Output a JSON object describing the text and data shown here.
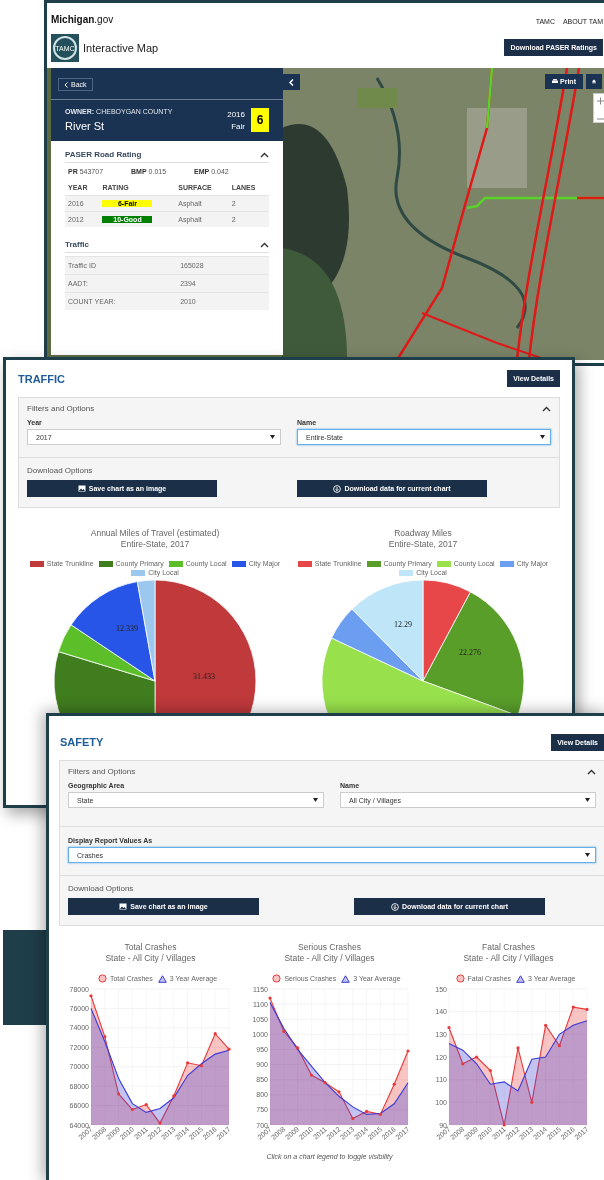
{
  "map_window": {
    "site_title": "**Michigan**.gov",
    "nav_links": [
      "TAMC",
      "ABOUT TAM"
    ],
    "logo_text": "TAMC",
    "app_title": "Interactive Map",
    "download_button": "Download PASER Ratings",
    "print_button": "Print",
    "sidebar": {
      "back_button": "Back",
      "owner": "**OWNER:** CHEBOYGAN COUNTY",
      "road_name": "River St",
      "rating_year": "2016",
      "rating_label": "Fair",
      "rating_value": "6",
      "sections": [
        {
          "kind": "paser",
          "title": "PASER Road Rating",
          "expanded": true,
          "stats": [
            {
              "label": "PR",
              "value": "543707"
            },
            {
              "label": "BMP",
              "value": "0.015"
            },
            {
              "label": "EMP",
              "value": "0.042"
            }
          ],
          "columns": [
            "YEAR",
            "RATING",
            "SURFACE",
            "LANES"
          ],
          "rows": [
            {
              "year": "2016",
              "rating": "6-Fair",
              "color": "#ffff00",
              "surface": "Asphalt",
              "lanes": "2"
            },
            {
              "year": "2012",
              "rating": "10-Good",
              "color": "#008000",
              "surface": "Asphalt",
              "lanes": "2"
            }
          ]
        },
        {
          "kind": "traffic",
          "title": "Traffic",
          "expanded": true,
          "rows": [
            {
              "label": "Traffic ID",
              "value": "165028"
            },
            {
              "label": "AADT:",
              "value": "2394"
            },
            {
              "label": "COUNT YEAR:",
              "value": "2010"
            }
          ]
        }
      ]
    }
  },
  "traffic_window": {
    "title": "TRAFFIC",
    "view_button": "View Details",
    "filters": {
      "title": "Filters and Options",
      "expanded": true,
      "rows": [
        [
          {
            "label": "Year",
            "value": "2017",
            "focused": false
          },
          {
            "label": "Name",
            "value": "Entire-State",
            "focused": true
          }
        ]
      ]
    },
    "download": {
      "title": "Download Options",
      "buttons": [
        {
          "kind": "image",
          "label": "Save chart as an image"
        },
        {
          "kind": "download",
          "label": "Download data for current chart"
        }
      ]
    },
    "charts": [
      {
        "title": "Annual Miles of Travel (estimated)",
        "subtitle": "Entire-State, 2017",
        "legend": [
          {
            "name": "State Trunkline",
            "color": "#c0393b"
          },
          {
            "name": "County Primary",
            "color": "#3f7d1e"
          },
          {
            "name": "County Local",
            "color": "#5cbf2a"
          },
          {
            "name": "City Major",
            "color": "#2755e8"
          },
          {
            "name": "City Local",
            "color": "#9cc8f0"
          }
        ],
        "slice_labels": [
          "12.339",
          "31.433"
        ]
      },
      {
        "title": "Roadway Miles",
        "subtitle": "Entire-State, 2017",
        "legend": [
          {
            "name": "State Trunkline",
            "color": "#e8474a"
          },
          {
            "name": "County Primary",
            "color": "#5a9e2a"
          },
          {
            "name": "County Local",
            "color": "#98e04c"
          },
          {
            "name": "City Major",
            "color": "#6b9ef0"
          },
          {
            "name": "City Local",
            "color": "#bfe6f8"
          }
        ],
        "slice_labels": [
          "12.29",
          "22.276"
        ]
      }
    ]
  },
  "safety_window": {
    "title": "SAFETY",
    "view_button": "View Details",
    "filters": {
      "title": "Filters and Options",
      "expanded": true,
      "rows": [
        [
          {
            "label": "Geographic Area",
            "value": "State",
            "focused": false
          },
          {
            "label": "Name",
            "value": "All City / Villages",
            "focused": false
          }
        ],
        [
          {
            "label": "Display Report Values As",
            "value": "Crashes",
            "focused": true
          }
        ]
      ]
    },
    "download": {
      "title": "Download Options",
      "buttons": [
        {
          "kind": "image",
          "label": "Save chart as an image"
        },
        {
          "kind": "download",
          "label": "Download data for current chart"
        }
      ]
    },
    "charts": [
      {
        "subtitle": "State - All City / Villages",
        "chart_data": {
          "type": "area",
          "title": "Total Crashes",
          "grid": true,
          "categories": [
            "2007",
            "2008",
            "2009",
            "2010",
            "2011",
            "2012",
            "2013",
            "2014",
            "2015",
            "2016",
            "2017"
          ],
          "ylim": [
            64000,
            78000
          ],
          "yticks": [
            64000,
            66000,
            68000,
            70000,
            72000,
            74000,
            76000,
            78000
          ],
          "stacked": false,
          "series": [
            {
              "name": "Total Crashes",
              "color": "#e83a3a",
              "values": [
                77300,
                73100,
                67200,
                65600,
                66100,
                64200,
                67000,
                70400,
                70100,
                73400,
                71800
              ]
            },
            {
              "name": "3 Year Average",
              "color": "#3a3ad8",
              "values": [
                76000,
                72600,
                68800,
                66200,
                65300,
                65700,
                66800,
                69100,
                70300,
                71300,
                71700
              ]
            }
          ]
        }
      },
      {
        "subtitle": "State - All City / Villages",
        "chart_data": {
          "type": "area",
          "title": "Serious Crashes",
          "grid": true,
          "categories": [
            "2007",
            "2008",
            "2009",
            "2010",
            "2011",
            "2012",
            "2013",
            "2014",
            "2015",
            "2016",
            "2017"
          ],
          "ylim": [
            700,
            1150
          ],
          "yticks": [
            700,
            750,
            800,
            850,
            900,
            950,
            1000,
            1050,
            1100,
            1150
          ],
          "stacked": false,
          "series": [
            {
              "name": "Serious Crashes",
              "color": "#e83a3a",
              "values": [
                1120,
                1010,
                955,
                865,
                840,
                810,
                722,
                745,
                735,
                835,
                945
              ]
            },
            {
              "name": "3 Year Average",
              "color": "#3a3ad8",
              "values": [
                1105,
                1020,
                950,
                895,
                840,
                795,
                760,
                735,
                738,
                770,
                840
              ]
            }
          ]
        }
      },
      {
        "subtitle": "State - All City / Villages",
        "chart_data": {
          "type": "area",
          "title": "Fatal Crashes",
          "grid": true,
          "categories": [
            "2007",
            "2008",
            "2009",
            "2010",
            "2011",
            "2012",
            "2013",
            "2014",
            "2015",
            "2016",
            "2017"
          ],
          "ylim": [
            90,
            150
          ],
          "yticks": [
            90,
            100,
            110,
            120,
            130,
            140,
            150
          ],
          "stacked": false,
          "series": [
            {
              "name": "Fatal Crashes",
              "color": "#e83a3a",
              "values": [
                133,
                117,
                120,
                114,
                90,
                124,
                100,
                134,
                125,
                142,
                141
              ]
            },
            {
              "name": "3 Year Average",
              "color": "#3a3ad8",
              "values": [
                126,
                123,
                117,
                108,
                109,
                105,
                119,
                120,
                130,
                134,
                136
              ]
            }
          ]
        }
      }
    ],
    "caption": "Click on a chart legend to toggle visibility"
  }
}
